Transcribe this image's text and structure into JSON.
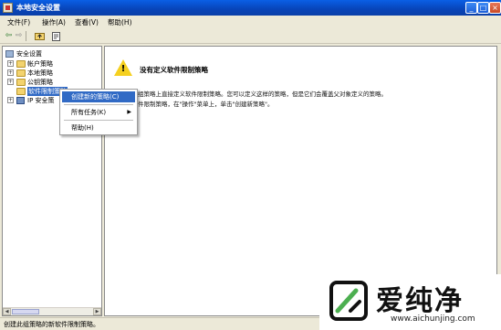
{
  "window": {
    "title": "本地安全设置",
    "controls": [
      "_",
      "□",
      "×"
    ]
  },
  "menubar": {
    "items": [
      "文件(F)",
      "操作(A)",
      "查看(V)",
      "帮助(H)"
    ]
  },
  "toolbar": {
    "icons": [
      "back-arrow-icon",
      "forward-arrow-icon",
      "up-folder-icon",
      "properties-icon"
    ]
  },
  "tree": {
    "root": "安全设置",
    "items": [
      {
        "label": "帐户策略",
        "expander": "+"
      },
      {
        "label": "本地策略",
        "expander": "+"
      },
      {
        "label": "公钥策略",
        "expander": "+"
      },
      {
        "label": "软件限制策略",
        "expander": ""
      },
      {
        "label": "IP 安全策",
        "expander": "+"
      }
    ]
  },
  "context_menu": {
    "items": [
      {
        "label": "创建新的策略(C)",
        "highlight": true
      },
      {
        "label": "所有任务(K)",
        "arrow": "▶"
      },
      {
        "label": "帮助(H)"
      }
    ]
  },
  "content": {
    "title": "没有定义软件限制策略",
    "lines": [
      "没有在该组策略上直接定义软件限制策略。您可以定义这样的策略，但是它们会覆盖父对象定义的策略。",
      "要创建软件限制策略，在\"操作\"菜单上，单击\"创建新策略\"。"
    ]
  },
  "statusbar": {
    "text": "创建此组策略的新软件限制策略。"
  },
  "watermark": {
    "brand": "爱纯净",
    "url": "www.aichunjing.com"
  },
  "colors": {
    "titlebar": "#0a5fe6",
    "selection": "#316ac5",
    "warning": "#f5d020"
  }
}
